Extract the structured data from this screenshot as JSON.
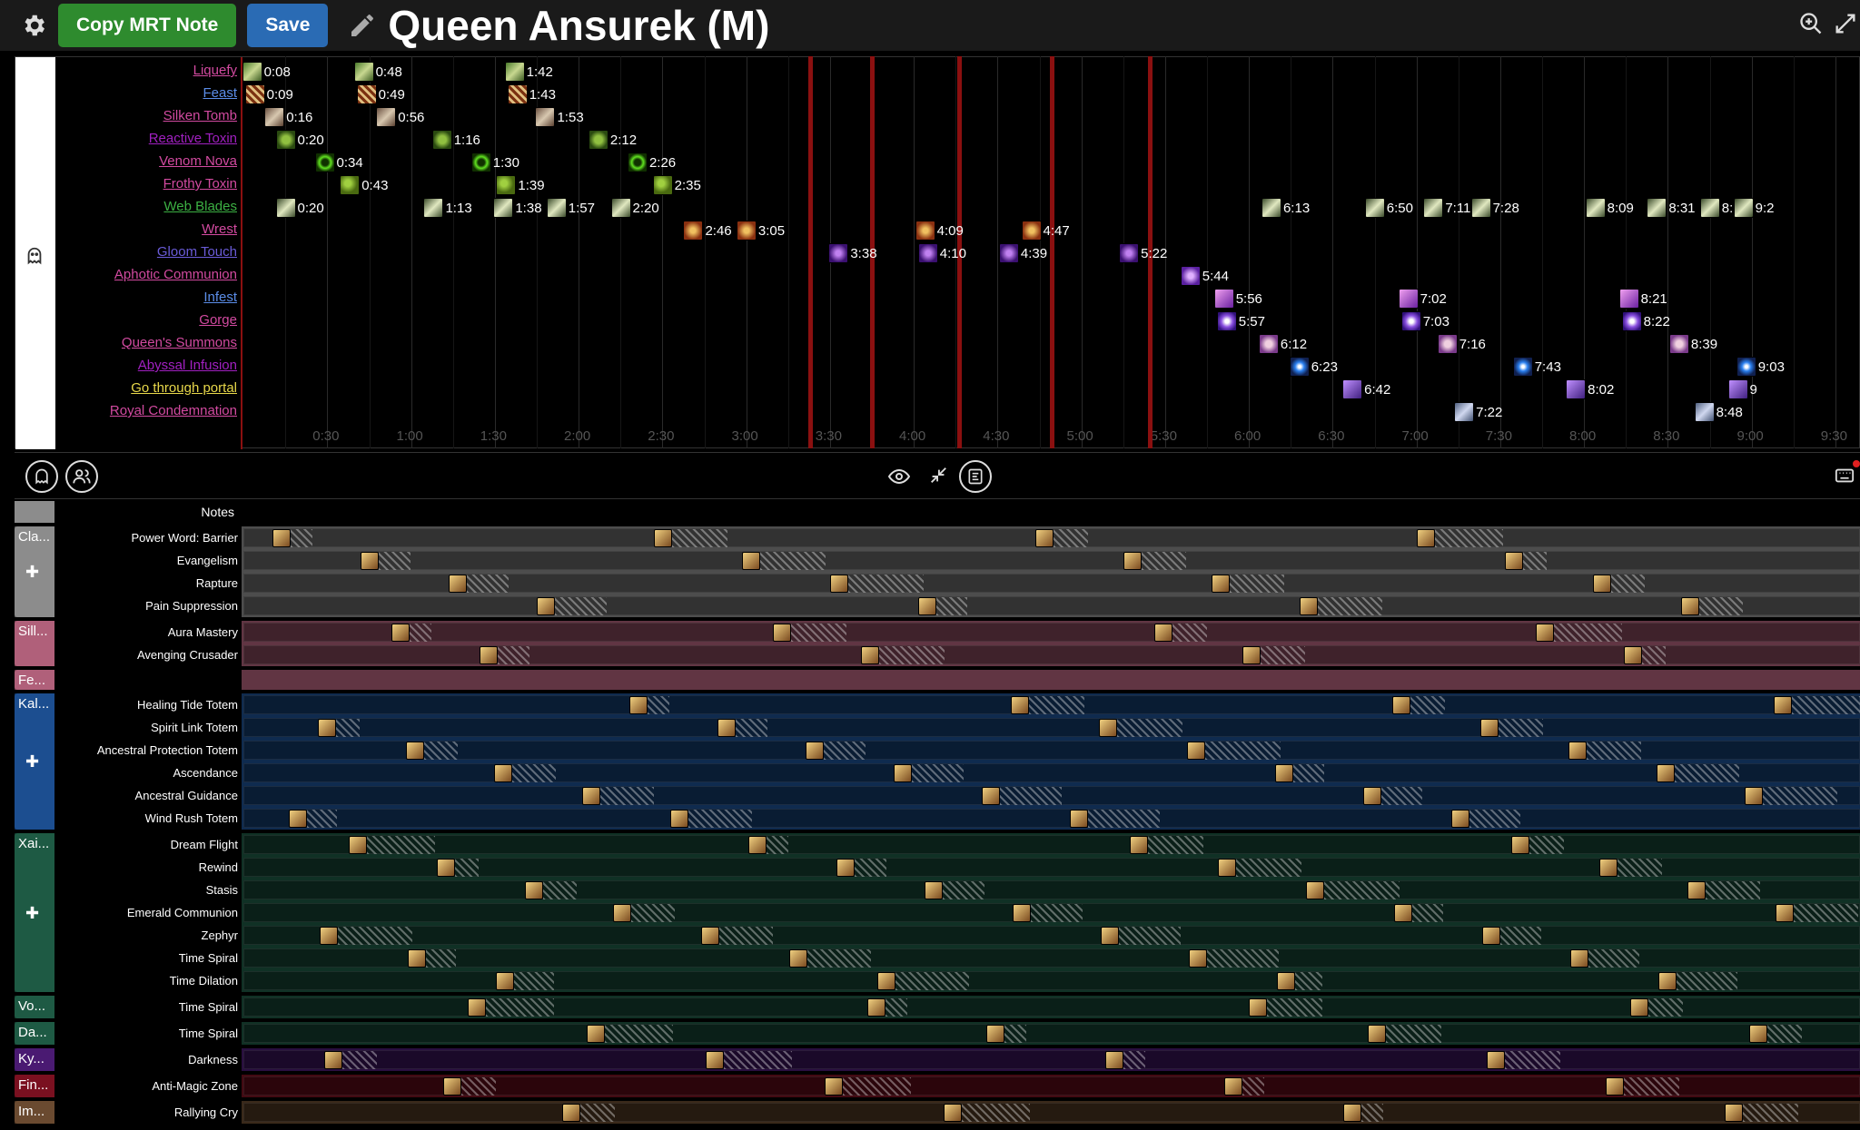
{
  "header": {
    "copy_label": "Copy MRT Note",
    "save_label": "Save",
    "title": "Queen Ansurek (M)"
  },
  "colors": {
    "accent_green": "#2e8b2e",
    "accent_blue": "#2a6bb4",
    "phase_line": "#8b1010"
  },
  "timeline": {
    "ticks": [
      "0:30",
      "1:00",
      "1:30",
      "2:00",
      "2:30",
      "3:00",
      "3:30",
      "4:00",
      "4:30",
      "5:00",
      "5:30",
      "6:00",
      "6:30",
      "7:00",
      "7:30",
      "8:00",
      "8:30",
      "9:00",
      "9:30"
    ]
  },
  "boss_abilities": [
    {
      "name": "Liquefy",
      "color": "#d24aa0",
      "icon": "green-spike",
      "casts": [
        "0:08",
        "0:48",
        "1:42"
      ]
    },
    {
      "name": "Feast",
      "color": "#5b8de8",
      "icon": "striped-claw",
      "casts": [
        "0:09",
        "0:49",
        "1:43"
      ]
    },
    {
      "name": "Silken Tomb",
      "color": "#d24aa0",
      "icon": "web",
      "casts": [
        "0:16",
        "0:56",
        "1:53"
      ]
    },
    {
      "name": "Reactive Toxin",
      "color": "#a020c0",
      "icon": "green-bomb",
      "casts": [
        "0:20",
        "1:16",
        "2:12"
      ]
    },
    {
      "name": "Venom Nova",
      "color": "#d24aa0",
      "icon": "green-nova",
      "casts": [
        "0:34",
        "1:30",
        "2:26"
      ]
    },
    {
      "name": "Frothy Toxin",
      "color": "#d24aa0",
      "icon": "green-bubbles",
      "casts": [
        "0:43",
        "1:39",
        "2:35"
      ]
    },
    {
      "name": "Web Blades",
      "color": "#3cb043",
      "icon": "blade",
      "casts": [
        "0:20",
        "1:13",
        "1:38",
        "1:57",
        "2:20",
        "6:13",
        "6:50",
        "7:11",
        "7:28",
        "8:09",
        "8:31",
        "8:50",
        "9:2"
      ]
    },
    {
      "name": "Wrest",
      "color": "#d24aa0",
      "icon": "fire-claw",
      "casts": [
        "2:46",
        "3:05",
        "4:09",
        "4:47"
      ]
    },
    {
      "name": "Gloom Touch",
      "color": "#6a5bd8",
      "icon": "purple-swirl",
      "casts": [
        "3:38",
        "4:10",
        "4:39",
        "5:22"
      ]
    },
    {
      "name": "Aphotic Communion",
      "color": "#d24aa0",
      "icon": "purple-vortex",
      "casts": [
        "5:44"
      ]
    },
    {
      "name": "Infest",
      "color": "#5b8de8",
      "icon": "purple-hand",
      "casts": [
        "5:56",
        "7:02",
        "8:21"
      ]
    },
    {
      "name": "Gorge",
      "color": "#d24aa0",
      "icon": "purple-orb",
      "casts": [
        "5:57",
        "7:03",
        "8:22"
      ]
    },
    {
      "name": "Queen's Summons",
      "color": "#d24aa0",
      "icon": "skull-crossbones",
      "casts": [
        "6:12",
        "7:16",
        "8:39"
      ]
    },
    {
      "name": "Abyssal Infusion",
      "color": "#a020c0",
      "icon": "blue-portal",
      "casts": [
        "6:23",
        "7:43",
        "9:03"
      ]
    },
    {
      "name": "Go through portal",
      "color": "#e8d84a",
      "icon": "void-claw",
      "casts": [
        "6:42",
        "8:02",
        "9"
      ]
    },
    {
      "name": "Royal Condemnation",
      "color": "#d24aa0",
      "icon": "grey-blade",
      "casts": [
        "7:22",
        "8:48"
      ]
    }
  ],
  "raid": {
    "notes_label": "Notes",
    "groups": [
      {
        "name": "Cla...",
        "color": "#8c8c8c",
        "rows": [
          "Power Word: Barrier",
          "Evangelism",
          "Rapture",
          "Pain Suppression"
        ]
      },
      {
        "name": "Sill...",
        "color": "#b0607a",
        "rows": [
          "Aura Mastery",
          "Avenging Crusader"
        ]
      },
      {
        "name": "Fe...",
        "color": "#b0607a",
        "rows": []
      },
      {
        "name": "Kal...",
        "color": "#1c4e90",
        "rows": [
          "Healing Tide Totem",
          "Spirit Link Totem",
          "Ancestral Protection Totem",
          "Ascendance",
          "Ancestral Guidance",
          "Wind Rush Totem"
        ]
      },
      {
        "name": "Xai...",
        "color": "#1e5a44",
        "rows": [
          "Dream Flight",
          "Rewind",
          "Stasis",
          "Emerald Communion",
          "Zephyr",
          "Time Spiral",
          "Time Dilation"
        ]
      },
      {
        "name": "Vo...",
        "color": "#1e5a44",
        "rows": [
          "Time Spiral"
        ]
      },
      {
        "name": "Da...",
        "color": "#1e5a44",
        "rows": [
          "Time Spiral"
        ]
      },
      {
        "name": "Ky...",
        "color": "#4a1a72",
        "rows": [
          "Darkness"
        ]
      },
      {
        "name": "Fin...",
        "color": "#7a1020",
        "rows": [
          "Anti-Magic Zone"
        ]
      },
      {
        "name": "Im...",
        "color": "#6a4a30",
        "rows": [
          "Rallying Cry"
        ]
      }
    ]
  }
}
